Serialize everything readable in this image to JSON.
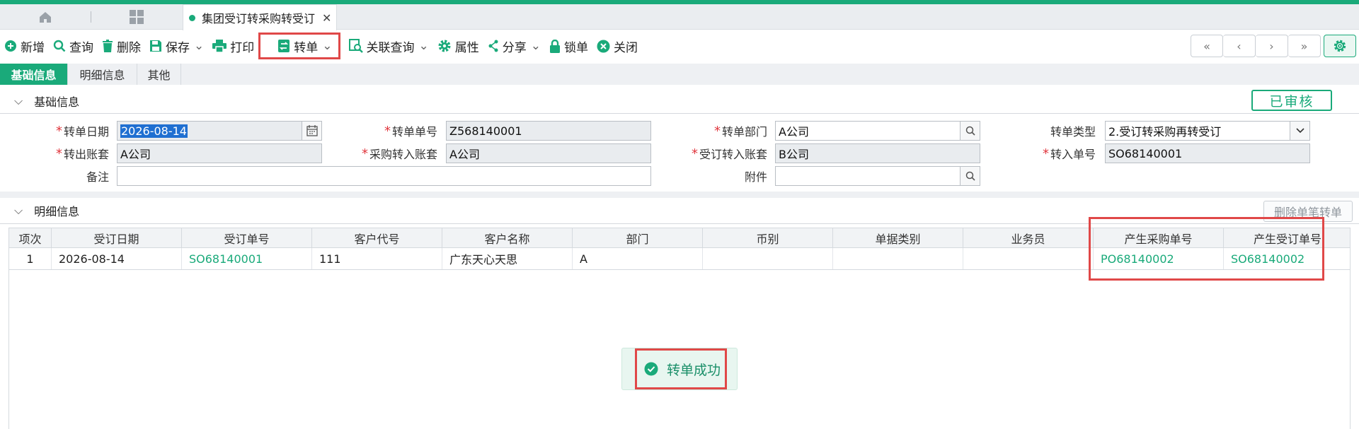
{
  "tabs": {
    "active_title": "集团受订转采购转受订"
  },
  "toolbar": {
    "new": "新增",
    "query": "查询",
    "delete": "删除",
    "save": "保存",
    "print": "打印",
    "transfer": "转单",
    "related_query": "关联查询",
    "properties": "属性",
    "share": "分享",
    "lock": "锁单",
    "close": "关闭"
  },
  "subtabs": [
    "基础信息",
    "明细信息",
    "其他"
  ],
  "basic_section": {
    "title": "基础信息",
    "status": "已审核",
    "fields": {
      "transfer_date_label": "转单日期",
      "transfer_date_value": "2026-08-14",
      "transfer_no_label": "转单单号",
      "transfer_no_value": "Z568140001",
      "transfer_dept_label": "转单部门",
      "transfer_dept_value": "A公司",
      "transfer_type_label": "转单类型",
      "transfer_type_value": "2.受订转采购再转受订",
      "out_account_label": "转出账套",
      "out_account_value": "A公司",
      "purchase_in_account_label": "采购转入账套",
      "purchase_in_account_value": "A公司",
      "order_in_account_label": "受订转入账套",
      "order_in_account_value": "B公司",
      "in_no_label": "转入单号",
      "in_no_value": "SO68140001",
      "remark_label": "备注",
      "remark_value": "",
      "attachment_label": "附件",
      "attachment_value": ""
    }
  },
  "detail_section": {
    "title": "明细信息",
    "delete_button": "删除单笔转单",
    "columns": [
      "项次",
      "受订日期",
      "受订单号",
      "客户代号",
      "客户名称",
      "部门",
      "币别",
      "单据类别",
      "业务员",
      "产生采购单号",
      "产生受订单号"
    ],
    "rows": [
      {
        "seq": "1",
        "order_date": "2026-08-14",
        "order_no": "SO68140001",
        "customer_code": "111",
        "customer_name": "广东天心天思",
        "dept": "A",
        "currency": "",
        "doc_type": "",
        "salesperson": "",
        "purchase_no": "PO68140002",
        "new_order_no": "SO68140002"
      }
    ]
  },
  "toast": {
    "message": "转单成功"
  },
  "colors": {
    "accent": "#1aaa7a",
    "highlight": "#e04848"
  }
}
